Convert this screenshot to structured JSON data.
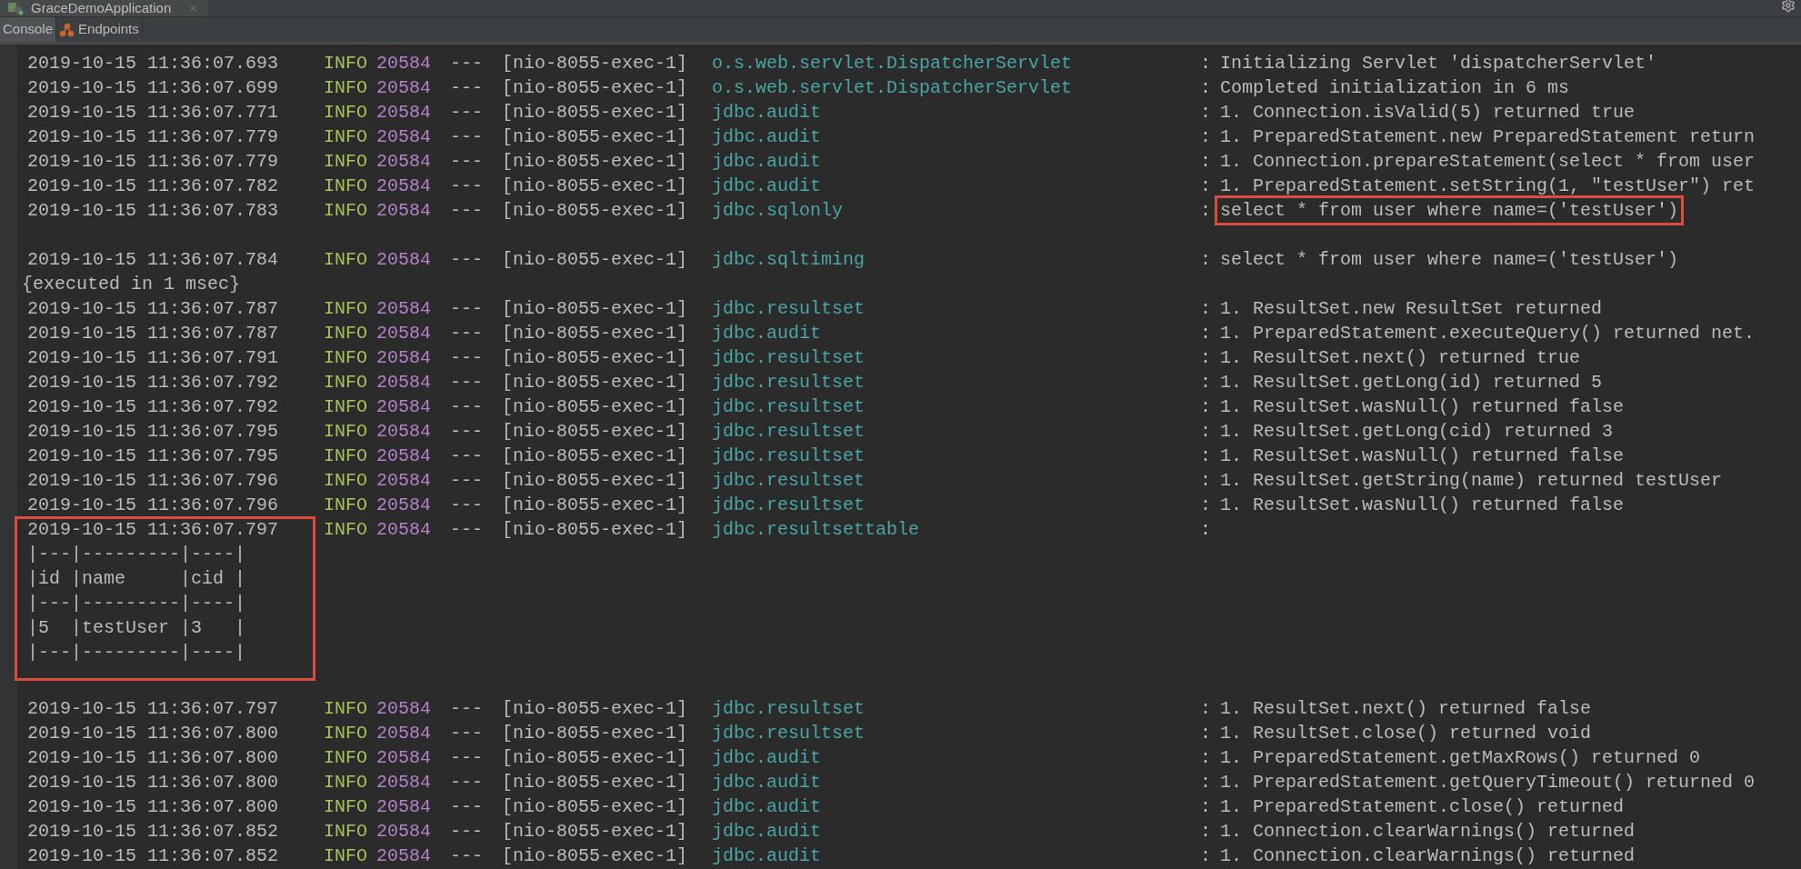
{
  "window": {
    "title": "GraceDemoApplication",
    "close": "×"
  },
  "tabs": [
    {
      "label": "Console",
      "selected": true
    },
    {
      "label": "Endpoints",
      "selected": false
    }
  ],
  "entries": [
    {
      "kind": "log",
      "timestamp": "2019-10-15 11:36:07.693",
      "level": "INFO",
      "pid": "20584",
      "separator": "---",
      "thread": "[nio-8055-exec-1]",
      "logger": "o.s.web.servlet.DispatcherServlet",
      "colon": ":",
      "message": "Initializing Servlet 'dispatcherServlet'",
      "highlighted": false
    },
    {
      "kind": "log",
      "timestamp": "2019-10-15 11:36:07.699",
      "level": "INFO",
      "pid": "20584",
      "separator": "---",
      "thread": "[nio-8055-exec-1]",
      "logger": "o.s.web.servlet.DispatcherServlet",
      "colon": ":",
      "message": "Completed initialization in 6 ms",
      "highlighted": false
    },
    {
      "kind": "log",
      "timestamp": "2019-10-15 11:36:07.771",
      "level": "INFO",
      "pid": "20584",
      "separator": "---",
      "thread": "[nio-8055-exec-1]",
      "logger": "jdbc.audit",
      "colon": ":",
      "message": "1. Connection.isValid(5) returned true",
      "highlighted": false
    },
    {
      "kind": "log",
      "timestamp": "2019-10-15 11:36:07.779",
      "level": "INFO",
      "pid": "20584",
      "separator": "---",
      "thread": "[nio-8055-exec-1]",
      "logger": "jdbc.audit",
      "colon": ":",
      "message": "1. PreparedStatement.new PreparedStatement return",
      "highlighted": false
    },
    {
      "kind": "log",
      "timestamp": "2019-10-15 11:36:07.779",
      "level": "INFO",
      "pid": "20584",
      "separator": "---",
      "thread": "[nio-8055-exec-1]",
      "logger": "jdbc.audit",
      "colon": ":",
      "message": "1. Connection.prepareStatement(select * from user",
      "highlighted": false
    },
    {
      "kind": "log",
      "timestamp": "2019-10-15 11:36:07.782",
      "level": "INFO",
      "pid": "20584",
      "separator": "---",
      "thread": "[nio-8055-exec-1]",
      "logger": "jdbc.audit",
      "colon": ":",
      "message": "1. PreparedStatement.setString(1, \"testUser\") ret",
      "highlighted": false
    },
    {
      "kind": "log",
      "timestamp": "2019-10-15 11:36:07.783",
      "level": "INFO",
      "pid": "20584",
      "separator": "---",
      "thread": "[nio-8055-exec-1]",
      "logger": "jdbc.sqlonly",
      "colon": ":",
      "message": "select * from user where name=('testUser')",
      "highlighted": true
    },
    {
      "kind": "gap"
    },
    {
      "kind": "log",
      "timestamp": "2019-10-15 11:36:07.784",
      "level": "INFO",
      "pid": "20584",
      "separator": "---",
      "thread": "[nio-8055-exec-1]",
      "logger": "jdbc.sqltiming",
      "colon": ":",
      "message": "select * from user where name=('testUser')",
      "highlighted": false
    },
    {
      "kind": "wrap",
      "text": "{executed in 1 msec}"
    },
    {
      "kind": "log",
      "timestamp": "2019-10-15 11:36:07.787",
      "level": "INFO",
      "pid": "20584",
      "separator": "---",
      "thread": "[nio-8055-exec-1]",
      "logger": "jdbc.resultset",
      "colon": ":",
      "message": "1. ResultSet.new ResultSet returned",
      "highlighted": false
    },
    {
      "kind": "log",
      "timestamp": "2019-10-15 11:36:07.787",
      "level": "INFO",
      "pid": "20584",
      "separator": "---",
      "thread": "[nio-8055-exec-1]",
      "logger": "jdbc.audit",
      "colon": ":",
      "message": "1. PreparedStatement.executeQuery() returned net.",
      "highlighted": false
    },
    {
      "kind": "log",
      "timestamp": "2019-10-15 11:36:07.791",
      "level": "INFO",
      "pid": "20584",
      "separator": "---",
      "thread": "[nio-8055-exec-1]",
      "logger": "jdbc.resultset",
      "colon": ":",
      "message": "1. ResultSet.next() returned true",
      "highlighted": false
    },
    {
      "kind": "log",
      "timestamp": "2019-10-15 11:36:07.792",
      "level": "INFO",
      "pid": "20584",
      "separator": "---",
      "thread": "[nio-8055-exec-1]",
      "logger": "jdbc.resultset",
      "colon": ":",
      "message": "1. ResultSet.getLong(id) returned 5",
      "highlighted": false
    },
    {
      "kind": "log",
      "timestamp": "2019-10-15 11:36:07.792",
      "level": "INFO",
      "pid": "20584",
      "separator": "---",
      "thread": "[nio-8055-exec-1]",
      "logger": "jdbc.resultset",
      "colon": ":",
      "message": "1. ResultSet.wasNull() returned false",
      "highlighted": false
    },
    {
      "kind": "log",
      "timestamp": "2019-10-15 11:36:07.795",
      "level": "INFO",
      "pid": "20584",
      "separator": "---",
      "thread": "[nio-8055-exec-1]",
      "logger": "jdbc.resultset",
      "colon": ":",
      "message": "1. ResultSet.getLong(cid) returned 3",
      "highlighted": false
    },
    {
      "kind": "log",
      "timestamp": "2019-10-15 11:36:07.795",
      "level": "INFO",
      "pid": "20584",
      "separator": "---",
      "thread": "[nio-8055-exec-1]",
      "logger": "jdbc.resultset",
      "colon": ":",
      "message": "1. ResultSet.wasNull() returned false",
      "highlighted": false
    },
    {
      "kind": "log",
      "timestamp": "2019-10-15 11:36:07.796",
      "level": "INFO",
      "pid": "20584",
      "separator": "---",
      "thread": "[nio-8055-exec-1]",
      "logger": "jdbc.resultset",
      "colon": ":",
      "message": "1. ResultSet.getString(name) returned testUser",
      "highlighted": false
    },
    {
      "kind": "log",
      "timestamp": "2019-10-15 11:36:07.796",
      "level": "INFO",
      "pid": "20584",
      "separator": "---",
      "thread": "[nio-8055-exec-1]",
      "logger": "jdbc.resultset",
      "colon": ":",
      "message": "1. ResultSet.wasNull() returned false",
      "highlighted": false
    },
    {
      "kind": "table",
      "highlighted": true,
      "row": {
        "timestamp": "2019-10-15 11:36:07.797",
        "level": "INFO",
        "pid": "20584",
        "separator": "---",
        "thread": "[nio-8055-exec-1]",
        "logger": "jdbc.resultsettable",
        "colon": ":"
      },
      "lines": [
        "|---|---------|----|",
        "|id |name     |cid |",
        "|---|---------|----|",
        "|5  |testUser |3   |",
        "|---|---------|----|"
      ]
    },
    {
      "kind": "gap"
    },
    {
      "kind": "log",
      "timestamp": "2019-10-15 11:36:07.797",
      "level": "INFO",
      "pid": "20584",
      "separator": "---",
      "thread": "[nio-8055-exec-1]",
      "logger": "jdbc.resultset",
      "colon": ":",
      "message": "1. ResultSet.next() returned false",
      "highlighted": false
    },
    {
      "kind": "log",
      "timestamp": "2019-10-15 11:36:07.800",
      "level": "INFO",
      "pid": "20584",
      "separator": "---",
      "thread": "[nio-8055-exec-1]",
      "logger": "jdbc.resultset",
      "colon": ":",
      "message": "1. ResultSet.close() returned void",
      "highlighted": false
    },
    {
      "kind": "log",
      "timestamp": "2019-10-15 11:36:07.800",
      "level": "INFO",
      "pid": "20584",
      "separator": "---",
      "thread": "[nio-8055-exec-1]",
      "logger": "jdbc.audit",
      "colon": ":",
      "message": "1. PreparedStatement.getMaxRows() returned 0",
      "highlighted": false
    },
    {
      "kind": "log",
      "timestamp": "2019-10-15 11:36:07.800",
      "level": "INFO",
      "pid": "20584",
      "separator": "---",
      "thread": "[nio-8055-exec-1]",
      "logger": "jdbc.audit",
      "colon": ":",
      "message": "1. PreparedStatement.getQueryTimeout() returned 0",
      "highlighted": false
    },
    {
      "kind": "log",
      "timestamp": "2019-10-15 11:36:07.800",
      "level": "INFO",
      "pid": "20584",
      "separator": "---",
      "thread": "[nio-8055-exec-1]",
      "logger": "jdbc.audit",
      "colon": ":",
      "message": "1. PreparedStatement.close() returned",
      "highlighted": false
    },
    {
      "kind": "log",
      "timestamp": "2019-10-15 11:36:07.852",
      "level": "INFO",
      "pid": "20584",
      "separator": "---",
      "thread": "[nio-8055-exec-1]",
      "logger": "jdbc.audit",
      "colon": ":",
      "message": "1. Connection.clearWarnings() returned",
      "highlighted": false
    },
    {
      "kind": "log",
      "timestamp": "2019-10-15 11:36:07.852",
      "level": "INFO",
      "pid": "20584",
      "separator": "---",
      "thread": "[nio-8055-exec-1]",
      "logger": "jdbc.audit",
      "colon": ":",
      "message": "1. Connection.clearWarnings() returned",
      "highlighted": false
    }
  ]
}
